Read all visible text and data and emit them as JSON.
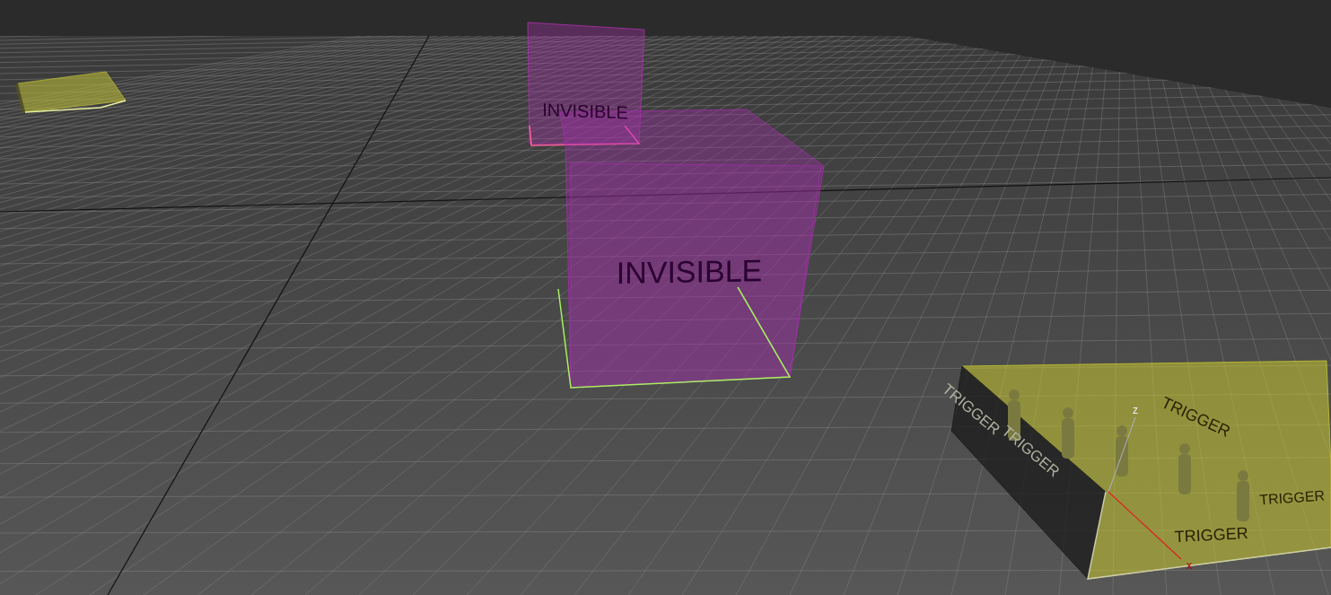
{
  "viewport": {
    "objects": [
      {
        "kind": "trigger_box"
      },
      {
        "kind": "invisible_box",
        "labels": [
          "INVISIBLE"
        ]
      },
      {
        "kind": "invisible_box",
        "labels": [
          "INVISIBLE"
        ]
      },
      {
        "kind": "trigger_box",
        "labels": [
          "TRIGGER",
          "TRIGGER",
          "TRIGGER",
          "TRIGGER",
          "TRIGGER"
        ]
      }
    ],
    "gizmo": {
      "axes": [
        "z",
        "x"
      ]
    }
  }
}
